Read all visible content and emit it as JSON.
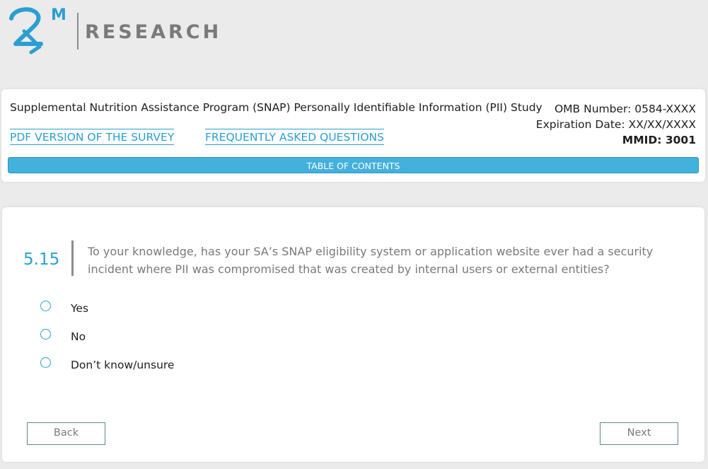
{
  "logo": {
    "mark_superscript": "M",
    "wordmark": "RESEARCH",
    "brand_color": "#2a9fd2"
  },
  "header": {
    "study_title": "Supplemental Nutrition Assistance Program (SNAP) Personally Identifiable Information (PII) Study",
    "omb_number": "OMB Number: 0584-XXXX",
    "expiration_date": "Expiration Date: XX/XX/XXXX",
    "mmid": "MMID: 3001",
    "links": {
      "pdf": "PDF VERSION OF THE SURVEY",
      "faq": "FREQUENTLY ASKED QUESTIONS"
    },
    "toc_label": "TABLE OF CONTENTS"
  },
  "question": {
    "number": "5.15",
    "text": "To your knowledge, has your SA’s SNAP eligibility system or application website ever had a security incident where PII was compromised that was created by internal users or external entities?",
    "options": [
      "Yes",
      "No",
      "Don’t know/unsure"
    ],
    "selected": null
  },
  "navigation": {
    "back_label": "Back",
    "next_label": "Next"
  },
  "colors": {
    "accent": "#2a9fd2",
    "toc_bar": "#44b0dc",
    "background": "#ebebeb"
  }
}
